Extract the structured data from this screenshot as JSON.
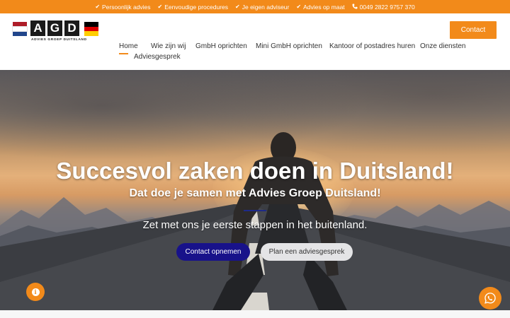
{
  "topbar": {
    "items": [
      {
        "icon": "check-icon",
        "text": "Persoonlijk advies"
      },
      {
        "icon": "check-icon",
        "text": "Eenvoudige procedures"
      },
      {
        "icon": "check-icon",
        "text": "Je eigen adviseur"
      },
      {
        "icon": "check-icon",
        "text": "Advies op maat"
      },
      {
        "icon": "phone-icon",
        "text": "0049 2822 9757 370"
      }
    ]
  },
  "logo": {
    "letters": [
      "A",
      "G",
      "D"
    ],
    "tagline": "ADVIES GROEP DUITSLAND"
  },
  "header": {
    "contact_label": "Contact"
  },
  "nav": {
    "items": [
      {
        "label": "Home",
        "active": true
      },
      {
        "label": "Wie zijn wij"
      },
      {
        "label": "GmbH oprichten"
      },
      {
        "label": "Mini GmbH oprichten"
      },
      {
        "label": "Kantoor of postadres huren"
      },
      {
        "label": "Onze diensten"
      },
      {
        "label": "Adviesgesprek"
      }
    ]
  },
  "hero": {
    "title": "Succesvol zaken doen in Duitsland!",
    "subtitle": "Dat doe je samen met Advies Groep Duitsland!",
    "tagline": "Zet met ons je eerste stappen in het buitenland.",
    "primary_cta": "Contact opnemen",
    "secondary_cta": "Plan een adviesgesprek"
  },
  "floating": {
    "info_icon": "info-icon",
    "whatsapp_icon": "whatsapp-icon"
  },
  "colors": {
    "accent": "#f28a1a",
    "primary_button": "#18128a",
    "secondary_button": "#e4e4e6"
  }
}
